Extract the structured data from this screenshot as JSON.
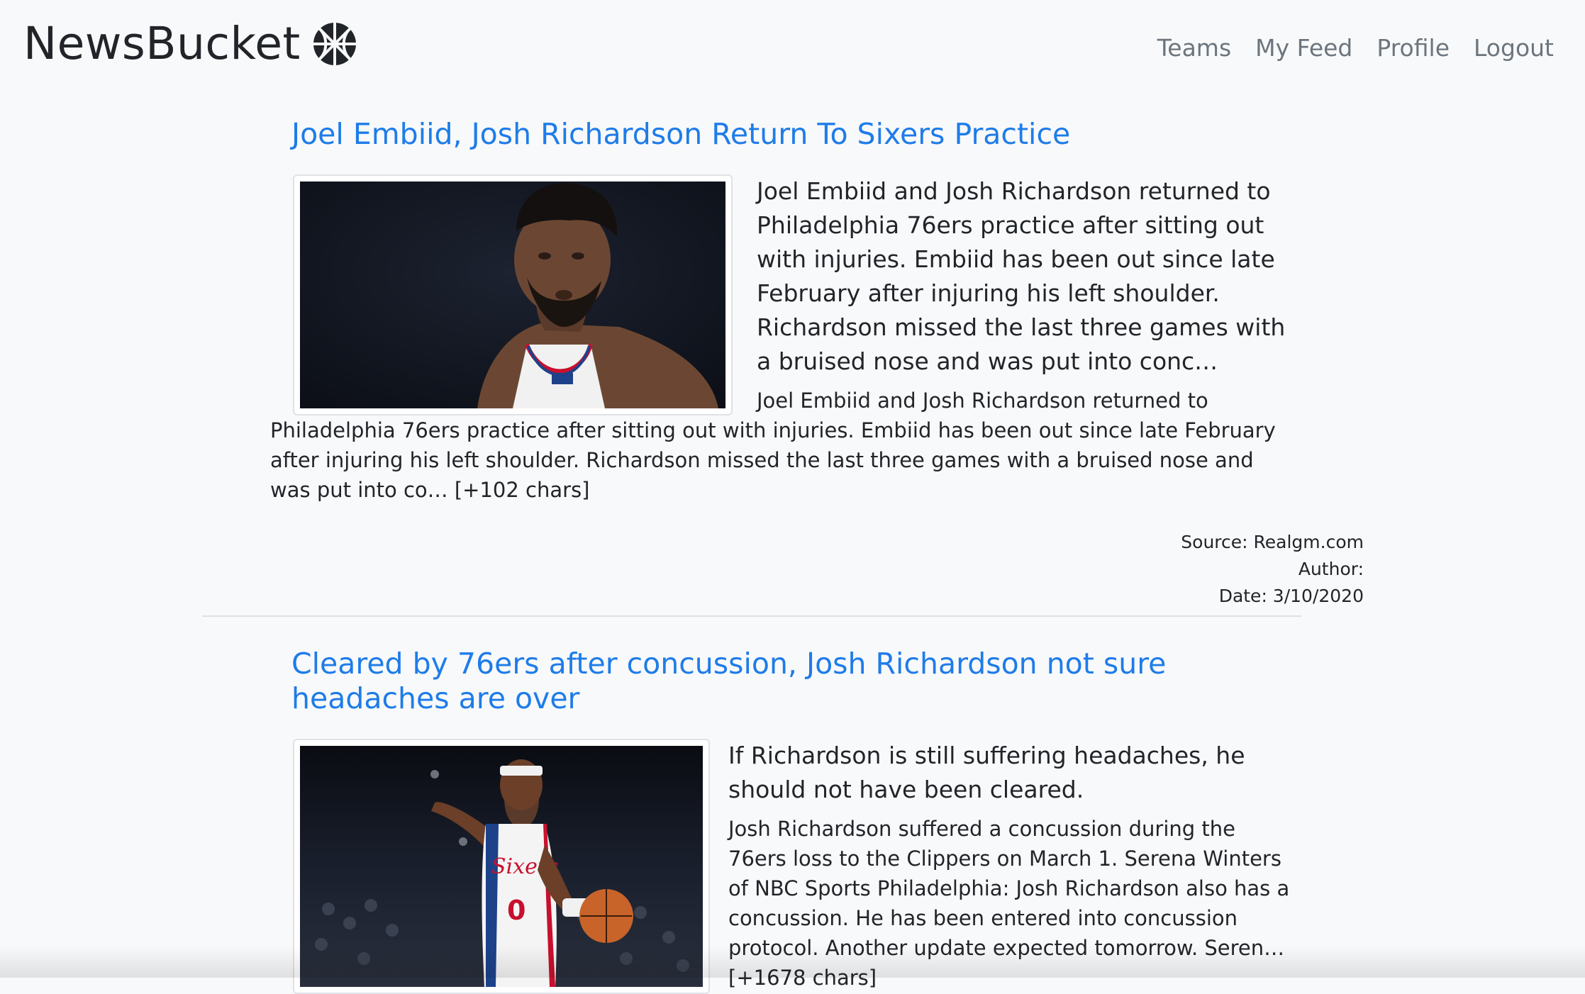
{
  "brand": {
    "name": "NewsBucket",
    "logo_icon": "basketball-icon"
  },
  "nav": {
    "links": [
      "Teams",
      "My Feed",
      "Profile",
      "Logout"
    ]
  },
  "articles": [
    {
      "title": "Joel Embiid, Josh Richardson Return To Sixers Practice",
      "image_icon": "player-photo",
      "description": "Joel Embiid and Josh Richardson returned to Philadelphia 76ers practice after sitting out with injuries. Embiid has been out since late February after injuring his left shoulder. Richardson missed the last three games with a bruised nose and was put into conc…",
      "content": "Joel Embiid and Josh Richardson returned to Philadelphia 76ers practice after sitting out with injuries. Embiid has been out since late February after injuring his left shoulder. Richardson missed the last three games with a bruised nose and was put into co… [+102 chars]",
      "source": "Source: Realgm.com",
      "author": "Author:",
      "date": "Date: 3/10/2020"
    },
    {
      "title": "Cleared by 76ers after concussion, Josh Richardson not sure headaches are over",
      "image_icon": "player-photo",
      "description": "If Richardson is still suffering headaches, he should not have been cleared.",
      "content": "Josh Richardson suffered a concussion during the 76ers loss to the Clippers on March 1. Serena Winters of NBC Sports Philadelphia: Josh Richardson also has a concussion. He has been entered into concussion protocol. Another update expected tomorrow. Seren… [+1678 chars]"
    }
  ],
  "colors": {
    "background": "#f8f9fa",
    "link": "#1e7ce9",
    "nav_link": "#6c757d",
    "text": "#212529",
    "divider": "#dee2e6"
  }
}
